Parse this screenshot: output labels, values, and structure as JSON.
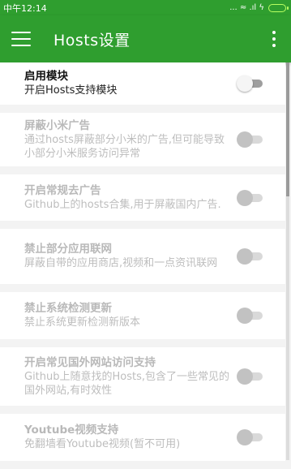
{
  "status_bar": {
    "time": "中午12:14",
    "icons_text": "... ≈ .ıl ϟ"
  },
  "app_bar": {
    "title": "Hosts设置",
    "menu_icon": "hamburger-menu",
    "more_icon": "more-vertical"
  },
  "settings": [
    {
      "title": "启用模块",
      "subtitle": "开启Hosts支持模块",
      "enabled": true,
      "checked": false
    },
    {
      "title": "屏蔽小米广告",
      "subtitle": "通过hosts屏蔽部分小米的广告,但可能导致小部分小米服务访问异常",
      "enabled": false,
      "checked": false
    },
    {
      "title": "开启常规去广告",
      "subtitle": "Github上的hosts合集,用于屏蔽国内广告.",
      "enabled": false,
      "checked": false
    },
    {
      "title": "禁止部分应用联网",
      "subtitle": "屏蔽自带的应用商店,视频和一点资讯联网",
      "enabled": false,
      "checked": false
    },
    {
      "title": "禁止系统检测更新",
      "subtitle": "禁止系统更新检测新版本",
      "enabled": false,
      "checked": false
    },
    {
      "title": "开启常见国外网站访问支持",
      "subtitle": "Github上随意找的Hosts,包含了一些常见的国外网站,有时效性",
      "enabled": false,
      "checked": false
    },
    {
      "title": "Youtube视频支持",
      "subtitle": "免翻墙看Youtube视频(暂不可用)",
      "enabled": false,
      "checked": false
    }
  ],
  "colors": {
    "primary": "#2f9e2f",
    "disabled_text": "#bdbdbd",
    "background": "#f3f3f3"
  }
}
